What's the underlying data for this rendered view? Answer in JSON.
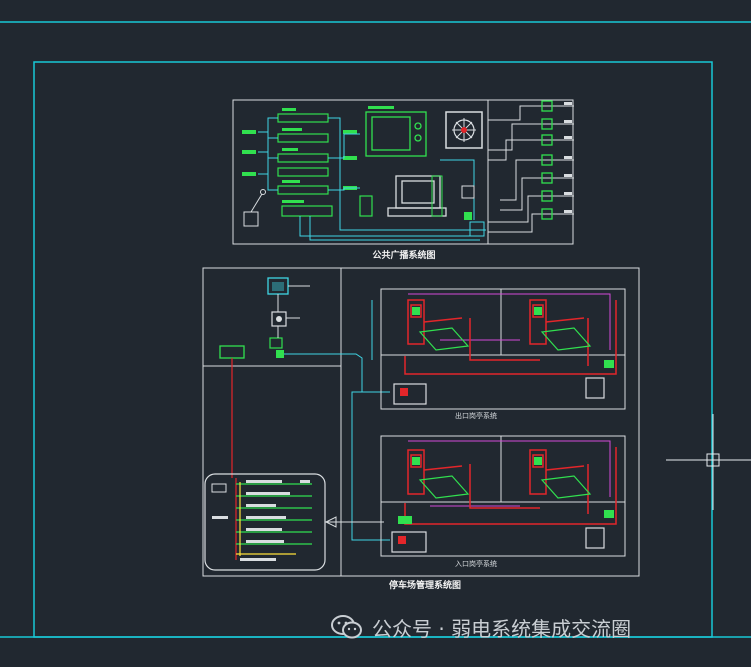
{
  "drawing": {
    "top_title": "公共广播系统图",
    "bottom_title": "停车场管理系统图",
    "entry_lane_label": "出口岗亭系统",
    "exit_lane_label": "入口岗亭系统"
  },
  "watermark": {
    "text": "公众号 · 弱电系统集成交流圈",
    "icon": "wechat-icon"
  },
  "colors": {
    "background": "#212830",
    "frame": "#19c7d6",
    "line_white": "#d9dde0",
    "line_cyan": "#3fd5e3",
    "line_green": "#31e04f",
    "line_red": "#e3262a",
    "line_magenta": "#d34ad8"
  }
}
